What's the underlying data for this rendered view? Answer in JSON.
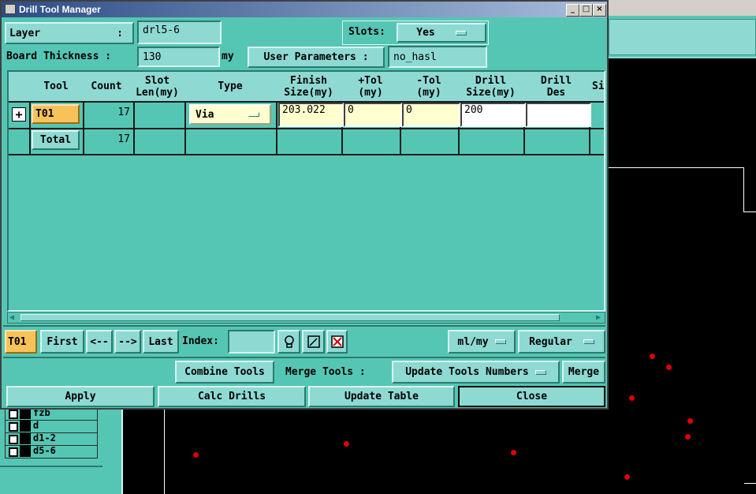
{
  "window": {
    "title": "Drill Tool Manager"
  },
  "header": {
    "layer_label": "Layer",
    "layer_colon": ":",
    "layer_value": "drl5-6",
    "slots_label": "Slots:",
    "slots_value": "Yes",
    "thickness_label": "Board Thickness :",
    "thickness_value": "130",
    "thickness_unit": "my",
    "user_params_label": "User Parameters :",
    "user_params_value": "no_hasl"
  },
  "table": {
    "columns": [
      "",
      "Tool",
      "Count",
      "Slot\nLen(my)",
      "Type",
      "Finish\nSize(my)",
      "+Tol\n(my)",
      "-Tol\n(my)",
      "Drill\nSize(my)",
      "Drill\nDes",
      "Si"
    ],
    "rows": [
      {
        "expand": "+",
        "tool": "T01",
        "count": "17",
        "slot_len": "",
        "type": "Via",
        "finish_size": "203.022",
        "plus_tol": "0",
        "minus_tol": "0",
        "drill_size": "200",
        "drill_des": ""
      }
    ],
    "total": {
      "label": "Total",
      "count": "17"
    }
  },
  "nav": {
    "current_tool": "T01",
    "first": "First",
    "prev": "<--",
    "next": "-->",
    "last": "Last",
    "index_label": "Index:",
    "index_value": "",
    "units": "ml/my",
    "mode": "Regular"
  },
  "actions": {
    "combine_tools": "Combine Tools",
    "merge_tools_label": "Merge Tools :",
    "merge_option": "Update Tools Numbers",
    "merge": "Merge",
    "apply": "Apply",
    "calc_drills": "Calc Drills",
    "update_table": "Update Table",
    "close": "Close"
  },
  "layers": [
    "fzb",
    "d",
    "d1-2",
    "d5-6"
  ],
  "colors": {
    "panel": "#56c6b4",
    "button": "#8fd9d3",
    "tool_highlight": "#f7c25a",
    "input_yellow": "#ffffd0",
    "dots": "#e00000"
  }
}
